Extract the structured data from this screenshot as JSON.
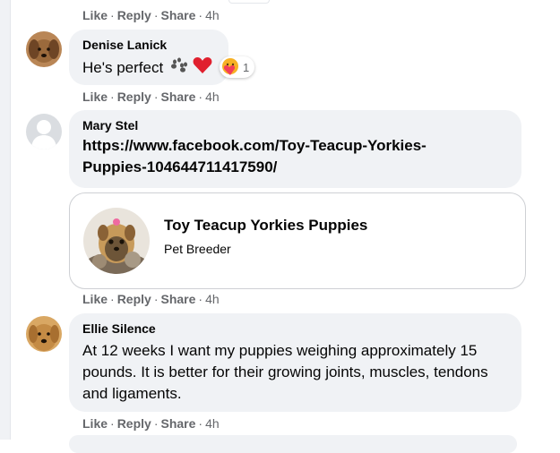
{
  "actions": {
    "like": "Like",
    "reply": "Reply",
    "share": "Share",
    "sep": "·"
  },
  "comments": [
    {
      "time": "4h"
    },
    {
      "name": "Denise Lanick",
      "text": "He's perfect",
      "reaction_count": "1",
      "time": "4h"
    },
    {
      "name": "Mary Stel",
      "link": "https://www.facebook.com/Toy-Teacup-Yorkies-Puppies-104644711417590/",
      "time": "4h"
    },
    {
      "name": "Ellie Silence",
      "text": "At 12 weeks I want my puppies weighing approximately 15 pounds. It is better for their growing joints, muscles, tendons and ligaments.",
      "time": "4h"
    }
  ],
  "link_card": {
    "title": "Toy Teacup Yorkies Puppies",
    "subtitle": "Pet Breeder"
  }
}
